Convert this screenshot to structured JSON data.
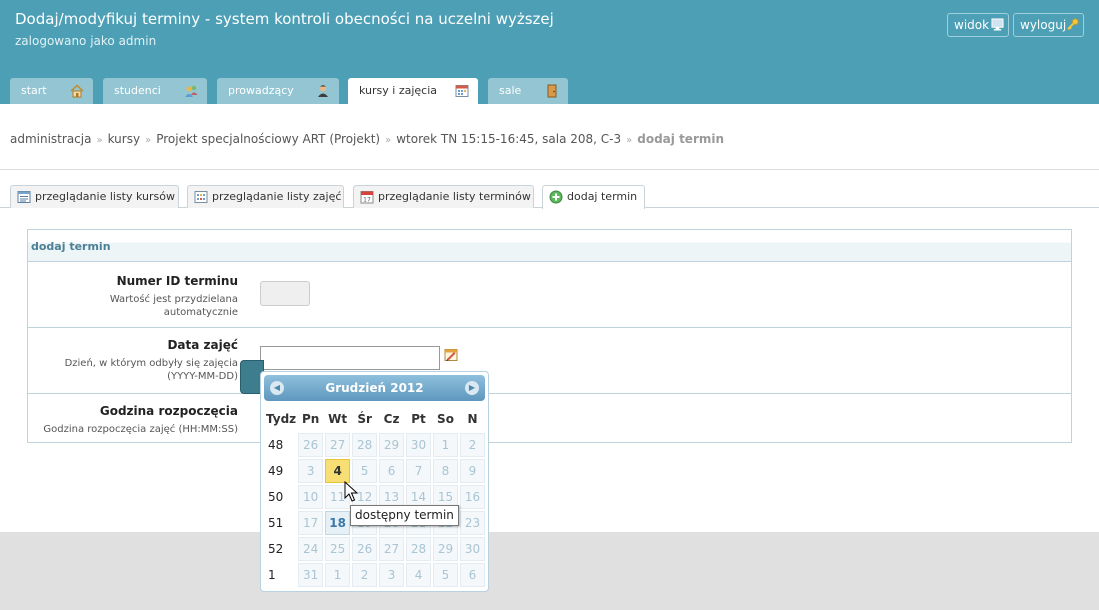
{
  "header": {
    "title": "Dodaj/modyfikuj terminy - system kontroli obecności na uczelni wyższej",
    "subtitle": "zalogowano jako admin",
    "buttons": {
      "view": "widok",
      "logout": "wyloguj"
    }
  },
  "tabs": [
    {
      "label": "start",
      "icon": "home-icon"
    },
    {
      "label": "studenci",
      "icon": "students-icon"
    },
    {
      "label": "prowadzący",
      "icon": "teacher-icon"
    },
    {
      "label": "kursy i zajęcia",
      "icon": "calendar-icon",
      "active": true
    },
    {
      "label": "sale",
      "icon": "door-icon"
    }
  ],
  "breadcrumb": {
    "items": [
      "administracja",
      "kursy",
      "Projekt specjalnościowy ART (Projekt)",
      "wtorek TN 15:15-16:45, sala 208, C-3"
    ],
    "current": "dodaj termin",
    "separator": "»"
  },
  "subtabs": [
    {
      "label": "przeglądanie listy kursów",
      "icon": "list-icon"
    },
    {
      "label": "przeglądanie listy zajęć",
      "icon": "grid-icon"
    },
    {
      "label": "przeglądanie listy terminów",
      "icon": "calendar-icon"
    },
    {
      "label": "dodaj termin",
      "icon": "add-icon",
      "active": true
    }
  ],
  "form": {
    "title": "dodaj termin",
    "fields": [
      {
        "label": "Numer ID terminu",
        "hint": "Wartość jest przydzielana automatycznie",
        "value": ""
      },
      {
        "label": "Data zajęć",
        "hint": "Dzień, w którym odbyły się zajęcia (YYYY-MM-DD)",
        "value": ""
      },
      {
        "label": "Godzina rozpoczęcia",
        "hint": "Godzina rozpoczęcia zajęć (HH:MM:SS)",
        "value": ""
      }
    ]
  },
  "calendar": {
    "month_title": "Grudzień 2012",
    "headers": [
      "Tydz",
      "Pn",
      "Wt",
      "Śr",
      "Cz",
      "Pt",
      "So",
      "N"
    ],
    "weeks": [
      {
        "week": "48",
        "days": [
          "26",
          "27",
          "28",
          "29",
          "30",
          "1",
          "2"
        ]
      },
      {
        "week": "49",
        "days": [
          "3",
          "4",
          "5",
          "6",
          "7",
          "8",
          "9"
        ]
      },
      {
        "week": "50",
        "days": [
          "10",
          "11",
          "12",
          "13",
          "14",
          "15",
          "16"
        ]
      },
      {
        "week": "51",
        "days": [
          "17",
          "18",
          "19",
          "20",
          "21",
          "22",
          "23"
        ]
      },
      {
        "week": "52",
        "days": [
          "24",
          "25",
          "26",
          "27",
          "28",
          "29",
          "30"
        ]
      },
      {
        "week": "1",
        "days": [
          "31",
          "1",
          "2",
          "3",
          "4",
          "5",
          "6"
        ]
      }
    ],
    "selected_day": "4",
    "available_day": "18",
    "tooltip": "dostępny termin"
  },
  "colors": {
    "header_bg": "#4c9fb5",
    "tab_bg": "#93c5d3",
    "selected_day": "#f7df73",
    "available_day": "#3c78a6"
  }
}
